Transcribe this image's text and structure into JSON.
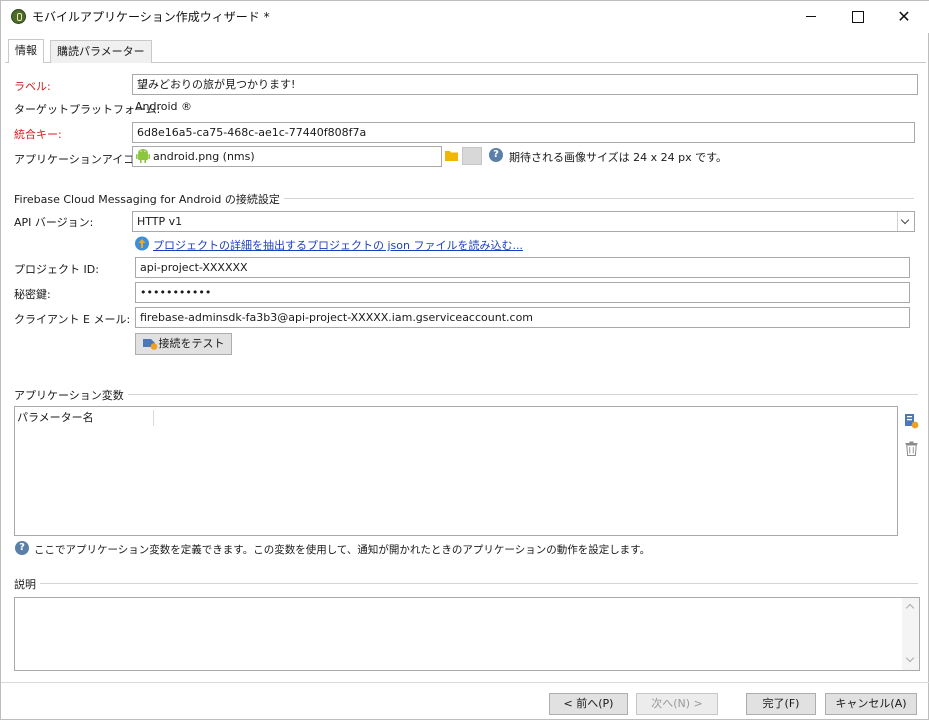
{
  "window": {
    "title": "モバイルアプリケーション作成ウィザード *",
    "minimize": "",
    "maximize": "",
    "close": "✕"
  },
  "tabs": [
    {
      "label": "情報"
    },
    {
      "label": "購読パラメーター"
    }
  ],
  "info": {
    "label_caption": "ラベル:",
    "label_value": "望みどおりの旅が見つかります!",
    "platform_caption": "ターゲットプラットフォーム:",
    "platform_value": "Android ®",
    "key_caption": "統合キー:",
    "key_value": "6d8e16a5-ca75-468c-ae1c-77440f808f7a",
    "icon_caption": "アプリケーションアイコン:",
    "icon_value": "android.png (nms)",
    "icon_hint": "期待される画像サイズは 24 x 24 px です。"
  },
  "fcm": {
    "section_title": "Firebase Cloud Messaging for Android の接続設定",
    "api_caption": "API バージョン:",
    "api_value": "HTTP v1",
    "extract_link": "プロジェクトの詳細を抽出するプロジェクトの json ファイルを読み込む...",
    "project_id_caption": "プロジェクト ID:",
    "project_id_value": "api-project-XXXXXX",
    "secret_caption": "秘密鍵:",
    "secret_value": "•••••••••••",
    "client_email_caption": "クライアント E メール:",
    "client_email_value": "firebase-adminsdk-fa3b3@api-project-XXXXX.iam.gserviceaccount.com",
    "test_button": "接続をテスト"
  },
  "variables": {
    "section_title": "アプリケーション変数",
    "column_header": "パラメーター名",
    "hint": "ここでアプリケーション変数を定義できます。この変数を使用して、通知が開かれたときのアプリケーションの動作を設定します。"
  },
  "description": {
    "section_title": "説明",
    "value": ""
  },
  "footer": {
    "prev": "< 前へ(P)",
    "next": "次へ(N) >",
    "finish": "完了(F)",
    "cancel": "キャンセル(A)"
  },
  "icons": {
    "app": "app-icon",
    "help": "?",
    "android": "android-icon",
    "folder": "folder-icon",
    "upload": "upload-icon",
    "test": "test-connection-icon",
    "add": "add-variable-icon",
    "delete": "trash-icon"
  },
  "colors": {
    "required_label": "#d01e1e",
    "link": "#1c3fbf",
    "help_icon": "#5a7fa8"
  }
}
